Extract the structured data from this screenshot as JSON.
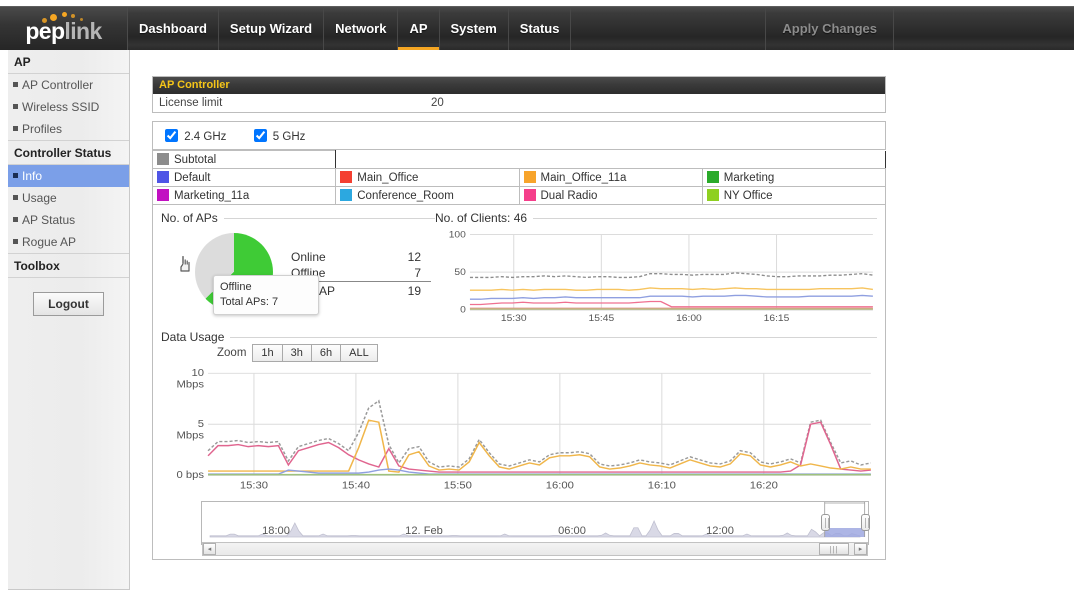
{
  "brand": {
    "name_part1": "pep",
    "name_part2": "link"
  },
  "nav": {
    "items": [
      {
        "label": "Dashboard",
        "active": false
      },
      {
        "label": "Setup Wizard",
        "active": false
      },
      {
        "label": "Network",
        "active": false
      },
      {
        "label": "AP",
        "active": true
      },
      {
        "label": "System",
        "active": false
      },
      {
        "label": "Status",
        "active": false
      }
    ],
    "apply_changes": "Apply Changes"
  },
  "sidebar": {
    "groups": [
      {
        "title": "AP",
        "items": [
          {
            "label": "AP Controller",
            "selected": false
          },
          {
            "label": "Wireless SSID",
            "selected": false
          },
          {
            "label": "Profiles",
            "selected": false
          }
        ]
      },
      {
        "title": "Controller Status",
        "items": [
          {
            "label": "Info",
            "selected": true
          },
          {
            "label": "Usage",
            "selected": false
          },
          {
            "label": "AP Status",
            "selected": false
          },
          {
            "label": "Rogue AP",
            "selected": false
          }
        ]
      },
      {
        "title": "Toolbox",
        "items": []
      }
    ],
    "logout_label": "Logout"
  },
  "ap_controller": {
    "panel_title": "AP Controller",
    "license_limit_label": "License limit",
    "license_limit_value": "20"
  },
  "frequency_filters": [
    {
      "label": "2.4 GHz",
      "checked": true
    },
    {
      "label": "5 GHz",
      "checked": true
    }
  ],
  "legend": {
    "subtotal": {
      "label": "Subtotal",
      "color": "#8c8c8c"
    },
    "entries": [
      {
        "label": "Default",
        "color": "#4f55e6"
      },
      {
        "label": "Main_Office",
        "color": "#f43f31"
      },
      {
        "label": "Main_Office_11a",
        "color": "#f7a42b"
      },
      {
        "label": "Marketing",
        "color": "#2aaa2a"
      },
      {
        "label": "Marketing_11a",
        "color": "#c210c2"
      },
      {
        "label": "Conference_Room",
        "color": "#2ca8e0"
      },
      {
        "label": "Dual Radio",
        "color": "#f53e8a"
      },
      {
        "label": "NY Office",
        "color": "#8ed020"
      }
    ]
  },
  "aps_chart": {
    "title": "No. of APs",
    "tooltip": {
      "name": "Offline",
      "detail": "Total APs: 7"
    },
    "rows": [
      {
        "key": "Online",
        "value": "12"
      },
      {
        "key": "Offline",
        "value": "7"
      },
      {
        "key": "Total AP",
        "value": "19"
      }
    ],
    "chart_data": {
      "type": "pie",
      "title": "No. of APs",
      "labels": [
        "Online",
        "Offline"
      ],
      "values": [
        12,
        7
      ],
      "colors": [
        "#3fcb36",
        "#dcdcdc"
      ],
      "total": 19,
      "start_angle_deg": 0,
      "hovered_slice": "Offline"
    }
  },
  "clients_chart": {
    "title": "No. of Clients: 46",
    "chart_data": {
      "type": "line",
      "title": "No. of Clients: 46",
      "ylabel": "",
      "xlabel": "",
      "ylim": [
        0,
        100
      ],
      "yticks": [
        0,
        50,
        100
      ],
      "ytick_labels": [
        "0",
        "50",
        "100"
      ],
      "xticks": [
        "15:30",
        "15:45",
        "16:00",
        "16:15"
      ],
      "grid": true,
      "legend_position": "external-top",
      "series": [
        {
          "name": "Subtotal",
          "color": "#8c8c8c",
          "dashed": true,
          "values": [
            43,
            43,
            43,
            44,
            43,
            44,
            44,
            45,
            44,
            45,
            44,
            43,
            44,
            44,
            43,
            43,
            44,
            48,
            48,
            47,
            47,
            46,
            47,
            47,
            47,
            49,
            48,
            47,
            45,
            44,
            44,
            45,
            45,
            45,
            46,
            46,
            47,
            48,
            46
          ]
        },
        {
          "name": "Main_Office_11a",
          "color": "#f7c45e",
          "dashed": false,
          "values": [
            26,
            26,
            26,
            27,
            26,
            27,
            26,
            27,
            27,
            27,
            26,
            26,
            27,
            27,
            27,
            26,
            27,
            29,
            28,
            28,
            28,
            27,
            28,
            27,
            28,
            29,
            28,
            28,
            27,
            27,
            27,
            27,
            27,
            28,
            28,
            28,
            28,
            29,
            27
          ]
        },
        {
          "name": "Default",
          "color": "#8f9fe0",
          "dashed": false,
          "values": [
            14,
            14,
            15,
            15,
            15,
            16,
            15,
            16,
            16,
            17,
            16,
            16,
            16,
            16,
            16,
            16,
            16,
            18,
            18,
            18,
            18,
            17,
            18,
            18,
            18,
            19,
            19,
            18,
            17,
            17,
            17,
            17,
            18,
            18,
            18,
            18,
            18,
            19,
            18
          ]
        },
        {
          "name": "Dual Radio",
          "color": "#ef7090",
          "dashed": false,
          "values": [
            7,
            7,
            8,
            9,
            9,
            10,
            9,
            9,
            9,
            10,
            9,
            9,
            9,
            9,
            9,
            9,
            10,
            11,
            11,
            4,
            4,
            4,
            4,
            4,
            4,
            4,
            4,
            4,
            4,
            4,
            4,
            4,
            4,
            4,
            4,
            4,
            4,
            4,
            4
          ]
        },
        {
          "name": "Main_Office",
          "color": "#e08a8a",
          "dashed": false,
          "values": [
            2,
            2,
            2,
            2,
            2,
            2,
            2,
            2,
            2,
            2,
            2,
            2,
            2,
            2,
            2,
            2,
            2,
            2,
            2,
            2,
            2,
            2,
            2,
            2,
            2,
            2,
            2,
            2,
            2,
            2,
            2,
            2,
            2,
            2,
            2,
            2,
            2,
            2,
            2
          ]
        },
        {
          "name": "Marketing",
          "color": "#bcc27d",
          "dashed": false,
          "values": [
            1,
            1,
            1,
            1,
            1,
            1,
            1,
            1,
            1,
            1,
            1,
            1,
            1,
            1,
            1,
            1,
            1,
            1,
            1,
            1,
            1,
            1,
            1,
            1,
            1,
            1,
            1,
            1,
            1,
            1,
            1,
            1,
            1,
            1,
            1,
            1,
            1,
            1,
            1
          ]
        }
      ]
    }
  },
  "usage_chart": {
    "title": "Data Usage",
    "zoom_label": "Zoom",
    "zoom_options": [
      "1h",
      "3h",
      "6h",
      "ALL"
    ],
    "chart_data": {
      "type": "line",
      "title": "Data Usage",
      "ylabel": "Mbps",
      "xlabel": "",
      "ylim": [
        0,
        10
      ],
      "yticks": [
        0,
        5,
        10
      ],
      "ytick_labels": [
        "0 bps",
        "5\nMbps",
        "10\nMbps"
      ],
      "xticks": [
        "15:30",
        "15:40",
        "15:50",
        "16:00",
        "16:10",
        "16:20"
      ],
      "grid": true,
      "series": [
        {
          "name": "Subtotal",
          "color": "#9a9a9a",
          "dashed": true,
          "values": [
            2.4,
            3.3,
            3.3,
            3.4,
            3.2,
            3.3,
            3.2,
            3.3,
            1.4,
            2.8,
            3.1,
            3.4,
            3.6,
            3.1,
            2.4,
            4.2,
            6.6,
            7.3,
            3.0,
            1.2,
            2.6,
            2.8,
            1.3,
            0.8,
            0.9,
            0.8,
            1.6,
            3.5,
            2.2,
            1.1,
            0.9,
            1.2,
            1.5,
            1.3,
            2.0,
            2.2,
            2.2,
            2.3,
            2.1,
            1.1,
            0.9,
            1.0,
            1.2,
            1.5,
            1.3,
            1.2,
            1.0,
            1.4,
            1.8,
            1.5,
            1.2,
            1.1,
            1.4,
            2.4,
            2.2,
            1.3,
            1.1,
            1.3,
            1.6,
            1.2,
            5.2,
            5.4,
            3.2,
            1.2,
            1.4,
            1.0,
            1.2
          ]
        },
        {
          "name": "Dual Radio",
          "color": "#e0658f",
          "dashed": false,
          "values": [
            1.9,
            2.9,
            2.9,
            3.0,
            2.8,
            2.9,
            2.8,
            2.9,
            1.0,
            2.4,
            2.7,
            3.0,
            3.2,
            2.7,
            2.0,
            1.5,
            1.1,
            0.8,
            2.6,
            0.9,
            0.6,
            0.5,
            0.4,
            0.3,
            0.3,
            0.3,
            0.3,
            0.3,
            0.3,
            0.3,
            0.3,
            0.3,
            0.3,
            0.3,
            0.3,
            0.3,
            0.3,
            0.3,
            0.3,
            0.3,
            0.3,
            0.3,
            0.3,
            0.3,
            0.3,
            0.3,
            0.3,
            0.3,
            0.3,
            0.3,
            0.3,
            0.3,
            0.3,
            0.3,
            0.3,
            0.3,
            0.3,
            0.3,
            0.4,
            1.0,
            5.0,
            5.2,
            3.0,
            0.6,
            0.5,
            0.4,
            0.5
          ]
        },
        {
          "name": "Main_Office_11a",
          "color": "#f0b64a",
          "dashed": false,
          "values": [
            0.4,
            0.4,
            0.4,
            0.4,
            0.4,
            0.4,
            0.4,
            0.4,
            0.4,
            0.4,
            0.4,
            0.4,
            0.4,
            0.4,
            0.4,
            2.7,
            5.4,
            5.2,
            0.4,
            0.3,
            2.0,
            2.3,
            0.9,
            0.5,
            0.6,
            0.5,
            1.3,
            3.2,
            1.9,
            0.8,
            0.6,
            0.9,
            1.2,
            1.0,
            1.7,
            1.9,
            1.9,
            2.0,
            1.8,
            0.8,
            0.6,
            0.7,
            0.9,
            1.2,
            1.0,
            0.9,
            0.7,
            1.1,
            1.5,
            1.2,
            0.9,
            0.8,
            1.1,
            2.1,
            1.9,
            1.0,
            0.8,
            1.0,
            1.3,
            0.9,
            1.1,
            0.9,
            0.7,
            0.6,
            0.8,
            0.6,
            0.6
          ]
        },
        {
          "name": "Default",
          "color": "#8f9fe0",
          "dashed": false,
          "values": [
            0.1,
            0.1,
            0.1,
            0.1,
            0.1,
            0.1,
            0.1,
            0.1,
            0.5,
            0.4,
            0.3,
            0.2,
            0.2,
            0.2,
            0.2,
            0.2,
            0.3,
            0.5,
            0.6,
            0.5,
            0.3,
            0.2,
            0.1,
            0.1,
            0.1,
            0.1,
            0.1,
            0.1,
            0.1,
            0.1,
            0.1,
            0.1,
            0.1,
            0.1,
            0.1,
            0.1,
            0.1,
            0.1,
            0.1,
            0.1,
            0.1,
            0.1,
            0.1,
            0.1,
            0.1,
            0.1,
            0.1,
            0.1,
            0.1,
            0.1,
            0.1,
            0.1,
            0.1,
            0.1,
            0.1,
            0.1,
            0.1,
            0.1,
            0.1,
            0.1,
            0.1,
            0.1,
            0.1,
            0.1,
            0.1,
            0.1,
            0.1
          ]
        },
        {
          "name": "Marketing",
          "color": "#9ec27d",
          "dashed": false,
          "values": [
            0.05,
            0.05,
            0.05,
            0.05,
            0.05,
            0.05,
            0.05,
            0.05,
            0.05,
            0.05,
            0.05,
            0.05,
            0.05,
            0.05,
            0.05,
            0.05,
            0.05,
            0.05,
            0.05,
            0.05,
            0.05,
            0.05,
            0.05,
            0.05,
            0.05,
            0.05,
            0.05,
            0.05,
            0.05,
            0.05,
            0.05,
            0.05,
            0.05,
            0.05,
            0.05,
            0.05,
            0.05,
            0.05,
            0.05,
            0.05,
            0.05,
            0.05,
            0.05,
            0.05,
            0.05,
            0.05,
            0.05,
            0.05,
            0.05,
            0.05,
            0.05,
            0.05,
            0.05,
            0.05,
            0.05,
            0.05,
            0.05,
            0.05,
            0.05,
            0.05,
            0.05,
            0.05,
            0.05,
            0.05,
            0.05,
            0.05,
            0.05
          ]
        }
      ]
    }
  },
  "navigator": {
    "xticks": [
      "18:00",
      "12. Feb",
      "06:00",
      "12:00"
    ],
    "selection_start_pct": 93.5,
    "selection_end_pct": 99.5,
    "scroll_left_arrow": "◂",
    "scroll_right_arrow": "▸",
    "grip": "|||"
  }
}
